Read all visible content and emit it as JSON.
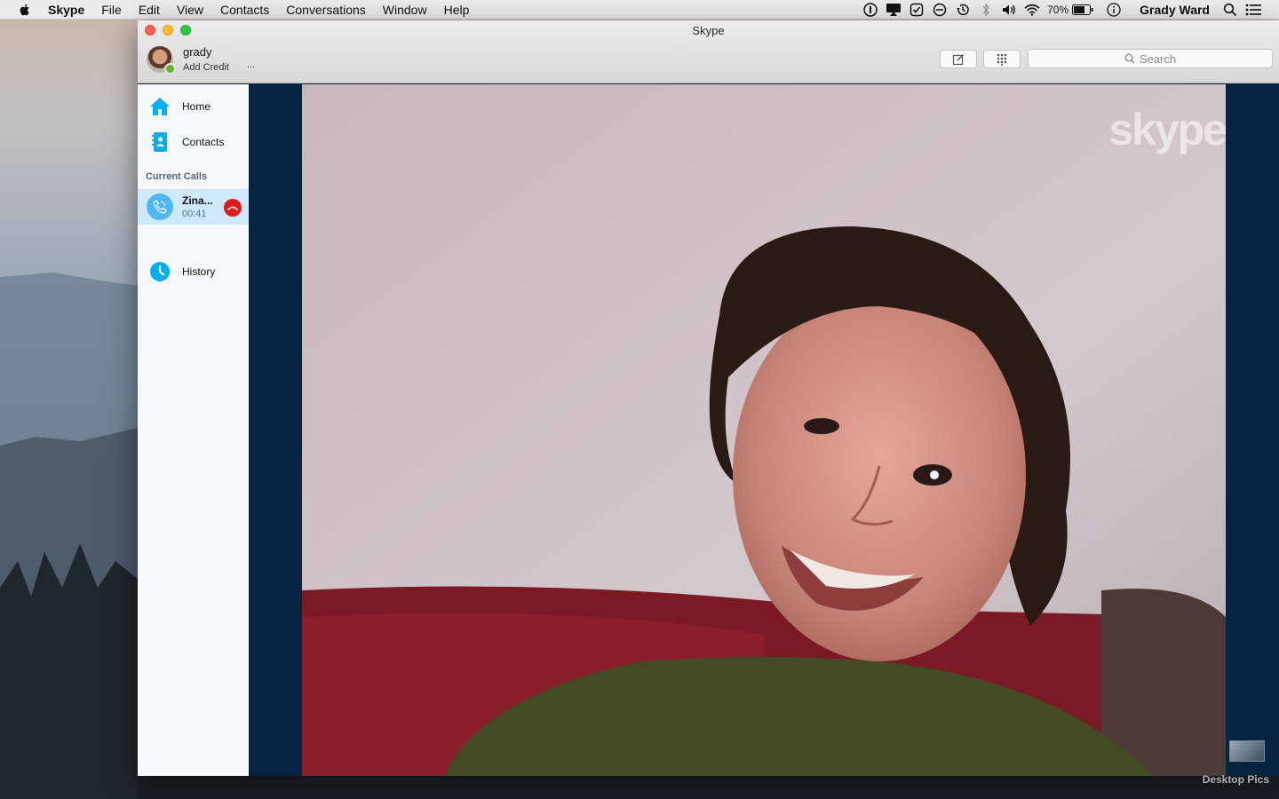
{
  "menubar": {
    "app_name": "Skype",
    "menus": [
      "File",
      "Edit",
      "View",
      "Contacts",
      "Conversations",
      "Window",
      "Help"
    ],
    "battery": "70%",
    "user": "Grady Ward",
    "status_icons": [
      "1password-icon",
      "airplay-icon",
      "checkmark-icon",
      "focus-icon",
      "time-machine-icon",
      "bluetooth-icon",
      "volume-icon",
      "wifi-icon"
    ]
  },
  "window": {
    "title": "Skype",
    "profile": {
      "name": "grady",
      "add_credit": "Add Credit",
      "more": "..."
    },
    "search_placeholder": "Search"
  },
  "sidebar": {
    "home": "Home",
    "contacts": "Contacts",
    "current_calls_label": "Current Calls",
    "call": {
      "name": "Zina...",
      "duration": "00:41"
    },
    "history": "History"
  },
  "video": {
    "watermark": "skype"
  },
  "desktop": {
    "label": "Desktop Pics"
  },
  "colors": {
    "skype_blue": "#00aff0",
    "hangup_red": "#e21a1a",
    "presence_green": "#5bb82f"
  }
}
